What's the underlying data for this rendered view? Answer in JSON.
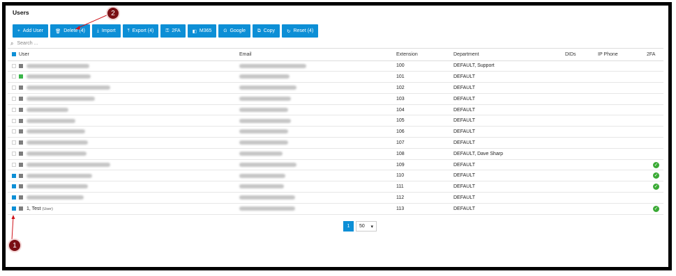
{
  "title": "Users",
  "toolbar": [
    {
      "label": "Add User",
      "icon": "plus-icon",
      "glyph": "+"
    },
    {
      "label": "Delete (4)",
      "icon": "trash-icon",
      "glyph": "🗑"
    },
    {
      "label": "Import",
      "icon": "import-icon",
      "glyph": "⤓"
    },
    {
      "label": "Export (4)",
      "icon": "export-icon",
      "glyph": "⤒"
    },
    {
      "label": "2FA",
      "icon": "2fa-icon",
      "glyph": "⚿"
    },
    {
      "label": "M365",
      "icon": "m365-icon",
      "glyph": "◧"
    },
    {
      "label": "Google",
      "icon": "google-icon",
      "glyph": "G"
    },
    {
      "label": "Copy",
      "icon": "copy-icon",
      "glyph": "⧉"
    },
    {
      "label": "Reset (4)",
      "icon": "reset-icon",
      "glyph": "↻"
    }
  ],
  "search": {
    "placeholder": "Search ..."
  },
  "columns": [
    "User",
    "Email",
    "Extension",
    "Department",
    "DIDs",
    "IP Phone",
    "2FA"
  ],
  "rows": [
    {
      "selected": false,
      "status": "gray",
      "name": "",
      "email": "",
      "ext": "100",
      "dept": "DEFAULT, Support",
      "twofa": false
    },
    {
      "selected": false,
      "status": "green",
      "name": "",
      "email": "",
      "ext": "101",
      "dept": "DEFAULT",
      "twofa": false
    },
    {
      "selected": false,
      "status": "gray",
      "name": "",
      "email": "",
      "ext": "102",
      "dept": "DEFAULT",
      "twofa": false
    },
    {
      "selected": false,
      "status": "gray",
      "name": "",
      "email": "",
      "ext": "103",
      "dept": "DEFAULT",
      "twofa": false
    },
    {
      "selected": false,
      "status": "gray",
      "name": "",
      "email": "",
      "ext": "104",
      "dept": "DEFAULT",
      "twofa": false
    },
    {
      "selected": false,
      "status": "gray",
      "name": "",
      "email": "",
      "ext": "105",
      "dept": "DEFAULT",
      "twofa": false
    },
    {
      "selected": false,
      "status": "gray",
      "name": "",
      "email": "",
      "ext": "106",
      "dept": "DEFAULT",
      "twofa": false
    },
    {
      "selected": false,
      "status": "gray",
      "name": "",
      "email": "",
      "ext": "107",
      "dept": "DEFAULT",
      "twofa": false
    },
    {
      "selected": false,
      "status": "gray",
      "name": "",
      "email": "",
      "ext": "108",
      "dept": "DEFAULT, Dave Sharp",
      "twofa": false
    },
    {
      "selected": false,
      "status": "gray",
      "name": "",
      "email": "",
      "ext": "109",
      "dept": "DEFAULT",
      "twofa": true
    },
    {
      "selected": true,
      "status": "gray",
      "name": "",
      "email": "",
      "ext": "110",
      "dept": "DEFAULT",
      "twofa": true
    },
    {
      "selected": true,
      "status": "gray",
      "name": "",
      "email": "",
      "ext": "111",
      "dept": "DEFAULT",
      "twofa": true
    },
    {
      "selected": true,
      "status": "gray",
      "name": "",
      "email": "",
      "ext": "112",
      "dept": "DEFAULT",
      "twofa": false
    },
    {
      "selected": true,
      "status": "gray",
      "name": "1, Test",
      "name_sub": "(User)",
      "email": "",
      "ext": "113",
      "dept": "DEFAULT",
      "twofa": true
    }
  ],
  "pager": {
    "current": "1",
    "page_size": "50"
  },
  "callouts": [
    "1",
    "2"
  ],
  "colors": {
    "accent": "#0d8fd6",
    "ok": "#3aaa35",
    "callout": "#7a0f14"
  }
}
